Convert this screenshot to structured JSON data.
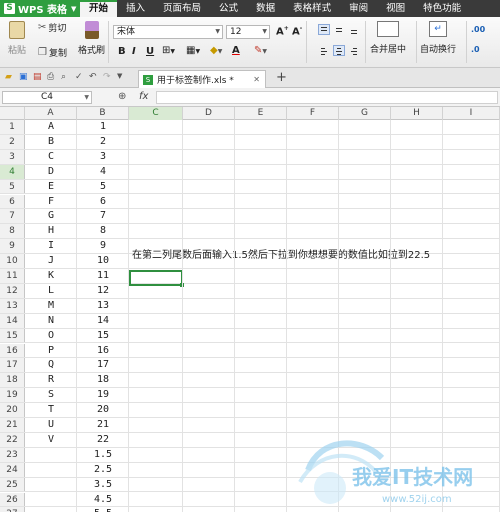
{
  "menu": {
    "app_button": "WPS 表格",
    "tabs": [
      "开始",
      "插入",
      "页面布局",
      "公式",
      "数据",
      "表格样式",
      "审阅",
      "视图",
      "特色功能"
    ],
    "active_tab": "开始"
  },
  "ribbon": {
    "cut": "剪切",
    "paste": "粘贴",
    "copy": "复制",
    "format_painter": "格式刷",
    "font_name": "宋体",
    "font_size": "12",
    "bold": "B",
    "italic": "I",
    "underline": "U",
    "merge_center": "合并居中",
    "wrap_text": "自动换行",
    "font_color_letter": "A"
  },
  "tabbar": {
    "document_name": "用于标签制作.xls *"
  },
  "formula_bar": {
    "name_box": "C4",
    "fx": "fx",
    "formula": ""
  },
  "sheet": {
    "columns": [
      "A",
      "B",
      "C",
      "D",
      "E",
      "F",
      "G",
      "H",
      "I"
    ],
    "selected_column": "C",
    "selected_row": 4,
    "active_cell": "C4",
    "row_numbers": [
      1,
      2,
      3,
      4,
      5,
      6,
      7,
      8,
      9,
      10,
      11,
      12,
      13,
      14,
      15,
      16,
      17,
      18,
      19,
      20,
      21,
      22,
      23,
      24,
      25,
      26,
      27,
      28
    ],
    "col_a": [
      "A",
      "B",
      "C",
      "D",
      "E",
      "F",
      "G",
      "H",
      "I",
      "J",
      "K",
      "L",
      "M",
      "N",
      "O",
      "P",
      "Q",
      "R",
      "S",
      "T",
      "U",
      "V",
      "",
      "",
      "",
      "",
      "",
      ""
    ],
    "col_b": [
      "1",
      "2",
      "3",
      "4",
      "5",
      "6",
      "7",
      "8",
      "9",
      "10",
      "11",
      "12",
      "13",
      "14",
      "15",
      "16",
      "17",
      "18",
      "19",
      "20",
      "21",
      "22",
      "1.5",
      "2.5",
      "3.5",
      "4.5",
      "5.5",
      "6.5"
    ],
    "note_c2": "在第二列尾数后面输入1.5然后下拉到你想想要的数值比如拉到22.5"
  },
  "watermark": {
    "text": "我爱IT技术网",
    "url": "www.52ij.com"
  }
}
